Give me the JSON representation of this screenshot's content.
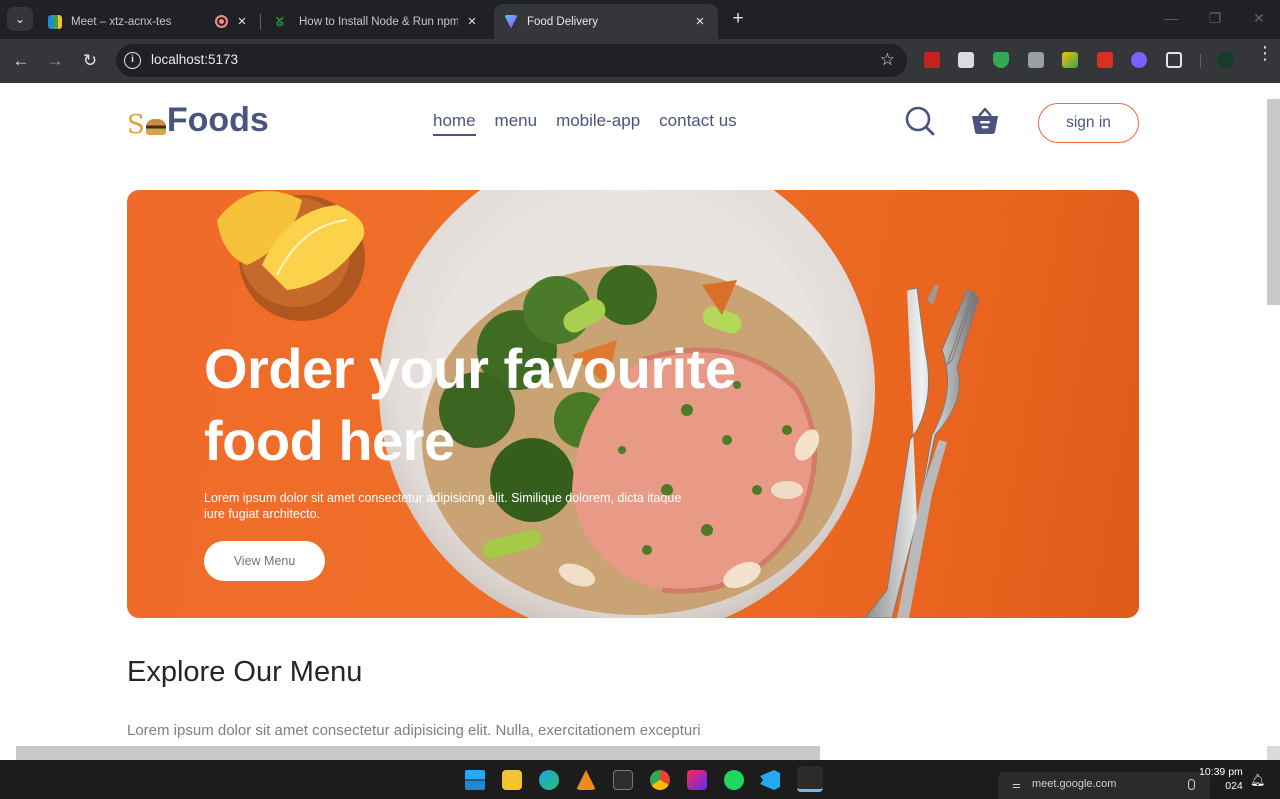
{
  "browser": {
    "tabs": [
      {
        "title": "Meet – xtz-acnx-tes",
        "active": false
      },
      {
        "title": "How to Install Node & Run npm in",
        "active": false
      },
      {
        "title": "Food Delivery",
        "active": true
      }
    ],
    "url": "localhost:5173"
  },
  "site": {
    "logo_prefix": "S",
    "logo_word": "Foods",
    "nav": {
      "home": "home",
      "menu": "menu",
      "mobile_app": "mobile-app",
      "contact": "contact us"
    },
    "signin_label": "sign in",
    "hero": {
      "title": "Order your favourite food here",
      "text": "Lorem ipsum dolor sit amet consectetur adipisicing elit. Similique dolorem, dicta itaque iure fugiat architecto.",
      "button": "View Menu"
    },
    "explore": {
      "heading": "Explore Our Menu",
      "text": "Lorem ipsum dolor sit amet consectetur adipisicing elit. Nulla, exercitationem excepturi"
    }
  },
  "taskbar": {
    "notification_site": "meet.google.com",
    "time": "10:39 pm",
    "date": "024"
  },
  "colors": {
    "accent": "#49557e",
    "hero": "#f06a2a",
    "signin_border": "tomato"
  }
}
